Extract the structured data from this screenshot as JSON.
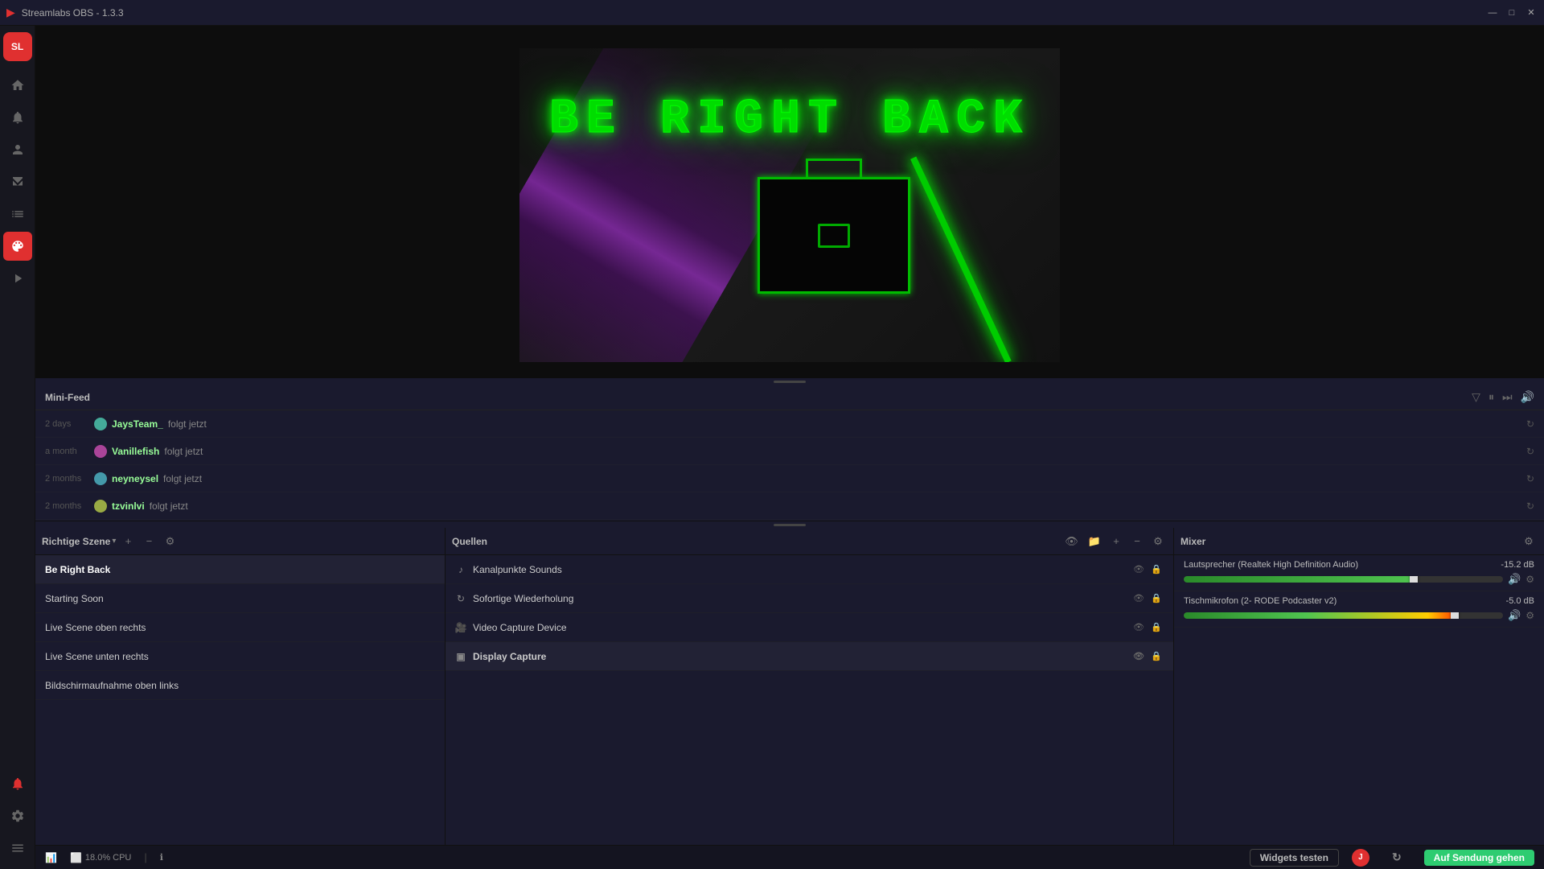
{
  "titlebar": {
    "title": "Streamlabs OBS - 1.3.3",
    "minimize": "—",
    "maximize": "□",
    "close": "✕"
  },
  "sidebar": {
    "icons": [
      {
        "name": "logo",
        "symbol": "SL",
        "label": "logo"
      },
      {
        "name": "home",
        "symbol": "⌂",
        "label": "home-icon"
      },
      {
        "name": "alert",
        "symbol": "🔔",
        "label": "alert-icon"
      },
      {
        "name": "person",
        "symbol": "👤",
        "label": "person-icon"
      },
      {
        "name": "store",
        "symbol": "🏪",
        "label": "store-icon"
      },
      {
        "name": "chart",
        "symbol": "📊",
        "label": "chart-icon"
      },
      {
        "name": "theme",
        "symbol": "🎨",
        "label": "theme-icon"
      },
      {
        "name": "highlight",
        "symbol": "⬛",
        "label": "highlight-icon"
      }
    ],
    "bottom_icons": [
      {
        "name": "warning",
        "symbol": "⚠",
        "label": "warning-icon"
      },
      {
        "name": "settings2",
        "symbol": "⚙",
        "label": "settings2-icon"
      },
      {
        "name": "settings3",
        "symbol": "☰",
        "label": "settings3-icon"
      }
    ]
  },
  "preview": {
    "brb_text": "BE RIGHT BACK"
  },
  "mini_feed": {
    "title": "Mini-Feed",
    "items": [
      {
        "time": "2 days",
        "username": "JaysTeam_",
        "action": "folgt jetzt",
        "avatar_color": "#4a9"
      },
      {
        "time": "a month",
        "username": "Vanillefish",
        "action": "folgt jetzt",
        "avatar_color": "#a49"
      },
      {
        "time": "2 months",
        "username": "neyneysel",
        "action": "folgt jetzt",
        "avatar_color": "#49a"
      },
      {
        "time": "2 months",
        "username": "tzvinlvi",
        "action": "folgt jetzt",
        "avatar_color": "#9a4"
      }
    ]
  },
  "scenes": {
    "title": "Richtige Szene",
    "add_label": "+",
    "remove_label": "−",
    "settings_label": "⚙",
    "items": [
      {
        "name": "Be Right Back",
        "active": true
      },
      {
        "name": "Starting Soon",
        "active": false
      },
      {
        "name": "Live Scene oben rechts",
        "active": false
      },
      {
        "name": "Live Scene unten rechts",
        "active": false
      },
      {
        "name": "Bildschirmaufnahme oben links",
        "active": false
      }
    ]
  },
  "sources": {
    "title": "Quellen",
    "items": [
      {
        "icon": "♪",
        "name": "Kanalpunkte Sounds"
      },
      {
        "icon": "↻",
        "name": "Sofortige Wiederholung"
      },
      {
        "icon": "🎥",
        "name": "Video Capture Device"
      },
      {
        "icon": "▣",
        "name": "Display Capture",
        "active": true
      }
    ]
  },
  "mixer": {
    "title": "Mixer",
    "devices": [
      {
        "name": "Lautsprecher (Realtek High Definition Audio)",
        "db": "-15.2 dB",
        "fill_pct": 72,
        "handle_pct": 72
      },
      {
        "name": "Tischmikrofon (2- RODE Podcaster v2)",
        "db": "-5.0 dB",
        "fill_pct": 85,
        "handle_pct": 85
      }
    ]
  },
  "statusbar": {
    "chart_icon": "📊",
    "cpu_icon": "⬜",
    "cpu_label": "18.0% CPU",
    "info_icon": "ℹ",
    "widgets_test": "Widgets testen",
    "go_live": "Auf Sendung gehen"
  }
}
